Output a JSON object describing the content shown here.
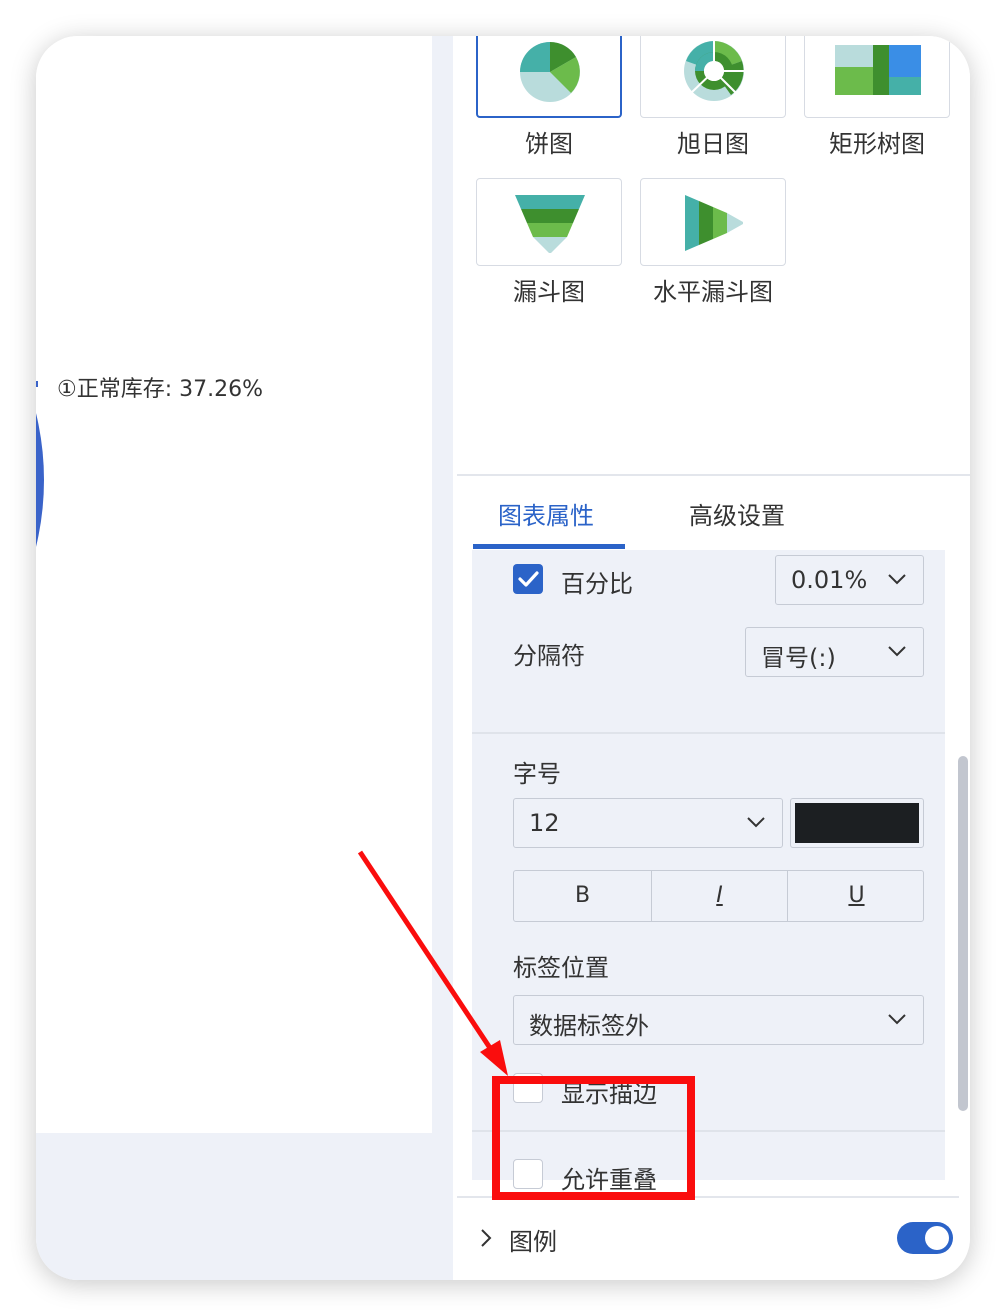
{
  "canvas": {
    "data_label": "①正常库存: 37.26%"
  },
  "chart_types": [
    {
      "label": "饼图",
      "icon": "pie-chart-icon",
      "selected": true
    },
    {
      "label": "旭日图",
      "icon": "sunburst-chart-icon",
      "selected": false
    },
    {
      "label": "矩形树图",
      "icon": "treemap-chart-icon",
      "selected": false
    },
    {
      "label": "漏斗图",
      "icon": "funnel-chart-icon",
      "selected": false
    },
    {
      "label": "水平漏斗图",
      "icon": "horizontal-funnel-chart-icon",
      "selected": false
    }
  ],
  "tabs": [
    {
      "label": "图表属性",
      "active": true
    },
    {
      "label": "高级设置",
      "active": false
    }
  ],
  "properties": {
    "percent": {
      "label": "百分比",
      "checked": true,
      "precision": "0.01%"
    },
    "separator": {
      "label": "分隔符",
      "value": "冒号(:)"
    },
    "font_size": {
      "label": "字号",
      "value": "12",
      "color": "#1c1f22"
    },
    "styles": {
      "bold": "B",
      "italic": "I",
      "underline": "U"
    },
    "label_position": {
      "label": "标签位置",
      "value": "数据标签外"
    },
    "show_stroke": {
      "label": "显示描边",
      "checked": false
    },
    "allow_overlap": {
      "label": "允许重叠",
      "checked": false
    }
  },
  "legend": {
    "label": "图例",
    "enabled": true
  },
  "colors": {
    "accent": "#2b63c8",
    "annotation": "#fa0d0d",
    "panel_bg": "#eef1f8"
  }
}
